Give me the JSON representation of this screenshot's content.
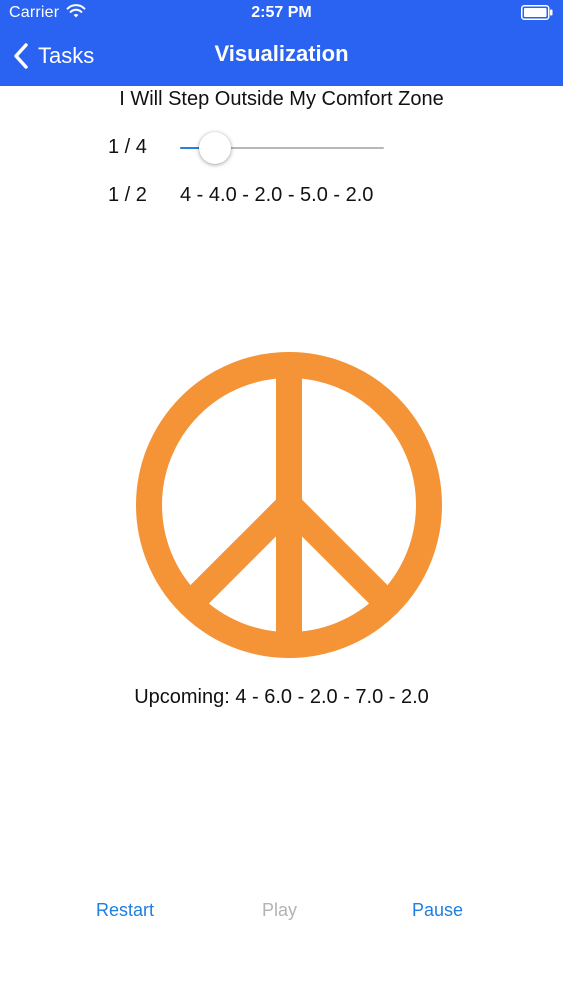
{
  "status_bar": {
    "carrier": "Carrier",
    "time": "2:57 PM"
  },
  "nav": {
    "back_label": "Tasks",
    "title": "Visualization"
  },
  "task": {
    "title": "I Will Step Outside My Comfort Zone",
    "step_counter": "1 / 4",
    "sub_counter": "1 / 2",
    "current_sequence": "4 - 4.0 - 2.0 - 5.0 - 2.0",
    "upcoming": "Upcoming: 4 - 6.0 - 2.0 - 7.0 - 2.0"
  },
  "slider": {
    "value": 1,
    "min": 1,
    "max": 4,
    "fraction": 0.17
  },
  "controls": {
    "restart_label": "Restart",
    "play_label": "Play",
    "pause_label": "Pause"
  },
  "icons": {
    "back": "chevron-left-icon",
    "wifi": "wifi-icon",
    "battery": "battery-icon",
    "visual": "peace-symbol-icon"
  },
  "colors": {
    "nav_bar": "#2a63f1",
    "accent": "#1f7ee0",
    "disabled": "#b3b3b3",
    "symbol": "#f49436",
    "slider_fill": "#2a7fe0"
  }
}
